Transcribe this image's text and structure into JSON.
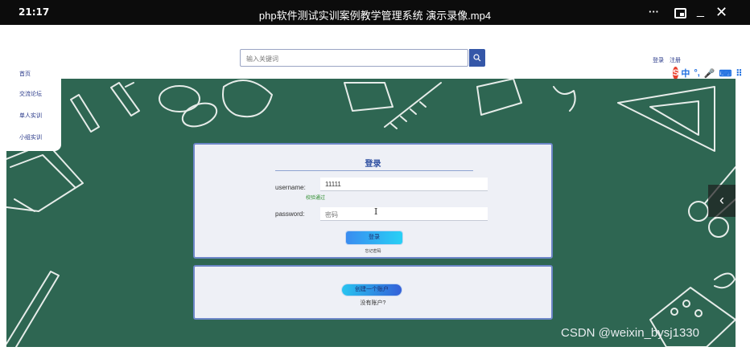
{
  "player": {
    "time": "21:17",
    "title": "php软件测试实训案例教学管理系统 演示录像.mp4",
    "controls": {
      "more": "···",
      "minimize": "_",
      "close": "✕"
    }
  },
  "header": {
    "search_placeholder": "输入关键词",
    "login_link": "登录",
    "register_link": "注册"
  },
  "ime": {
    "logo": "S",
    "items": [
      "中",
      "°,",
      "🎤",
      "⌨",
      "⠿"
    ]
  },
  "sidebar": {
    "items": [
      {
        "label": "首页"
      },
      {
        "label": "交流论坛"
      },
      {
        "label": "单人实训"
      },
      {
        "label": "小组实训"
      }
    ]
  },
  "login": {
    "title": "登录",
    "username_label": "username:",
    "username_value": "11111",
    "validation": "校验通过",
    "password_label": "password:",
    "password_placeholder": "密码",
    "login_button": "登录",
    "forgot_link": "忘记密码"
  },
  "signup": {
    "create_button": "创建一个账户",
    "no_account": "没有账户?"
  },
  "side_arrow": "‹",
  "watermark": "CSDN @weixin_bysj1330",
  "colors": {
    "board": "#2e6652",
    "accent": "#3557a8",
    "card_border": "#6d87c8"
  }
}
